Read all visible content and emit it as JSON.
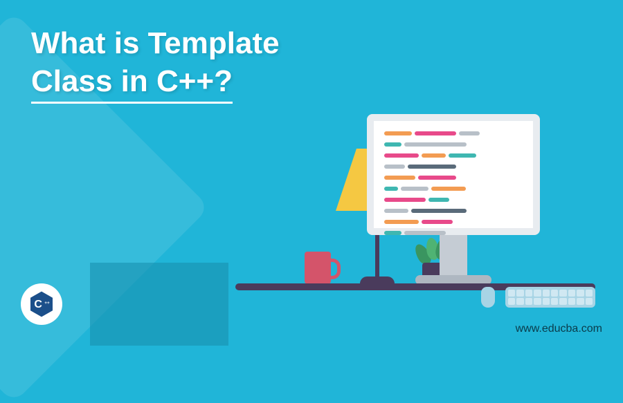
{
  "title": {
    "line1": "What is Template",
    "line2": "Class in C++?"
  },
  "logo": {
    "letter": "C",
    "suffix": "++"
  },
  "website_url": "www.educba.com",
  "code_colors": {
    "orange": "#f39c52",
    "pink": "#e84a8a",
    "cyan": "#3fb7b1",
    "grey": "#b8c0c8",
    "dark": "#5a6b7a"
  }
}
